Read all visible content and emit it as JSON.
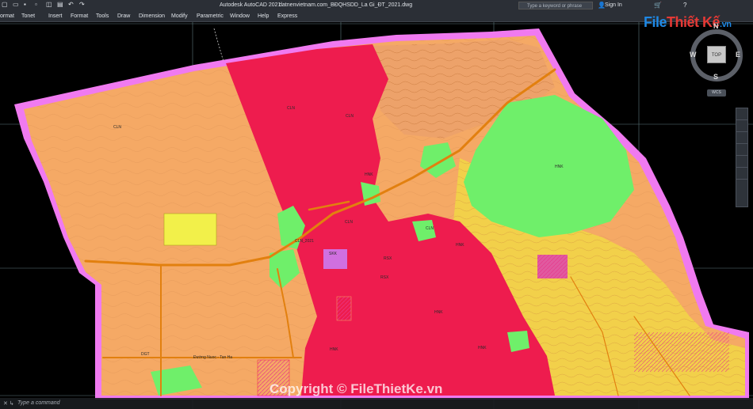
{
  "titlebar": {
    "app_title": "Autodesk AutoCAD 2021",
    "doc_title": "datnenvietnam.com_BĐQHSDD_La Gi_ĐT_2021.dwg",
    "search_placeholder": "Type a keyword or phrase",
    "sign_in": "Sign In"
  },
  "menu": [
    "ormat",
    "Tonet",
    "Insert",
    "Format",
    "Tools",
    "Draw",
    "Dimension",
    "Modify",
    "Parametric",
    "Window",
    "Help",
    "Express"
  ],
  "map_labels": {
    "cln1": "CLN",
    "cln2": "CLN",
    "cln3": "CLN",
    "cln4": "CLN",
    "cln5": "CLN",
    "hnk1": "HNK",
    "hnk2": "HNK",
    "hnk3": "HNK",
    "hnk4": "HNK",
    "hnk5": "HNK",
    "hnk6": "HNK",
    "rsx1": "RSX",
    "rsx2": "RSX",
    "skk": "SKK",
    "cln_year": "CLN_2021",
    "road": "Đường Nuoc - Tan Ha",
    "dgt": "DGT"
  },
  "navigation": {
    "compass_n": "N",
    "compass_s": "S",
    "compass_e": "E",
    "compass_w": "W",
    "top": "TOP",
    "wcs": "WCS"
  },
  "logo": {
    "part1": "File",
    "part2": "Thiết Kế",
    "part3": ".vn"
  },
  "watermark": "Copyright © FileThietKe.vn",
  "command": {
    "placeholder": "Type a command"
  },
  "colors": {
    "boundary": "#f07af0",
    "agri_land": "#f5a965",
    "forest_red": "#ee1c4e",
    "green": "#6fef6a",
    "yellow_field": "#f2e04a",
    "road": "#e2800f"
  }
}
